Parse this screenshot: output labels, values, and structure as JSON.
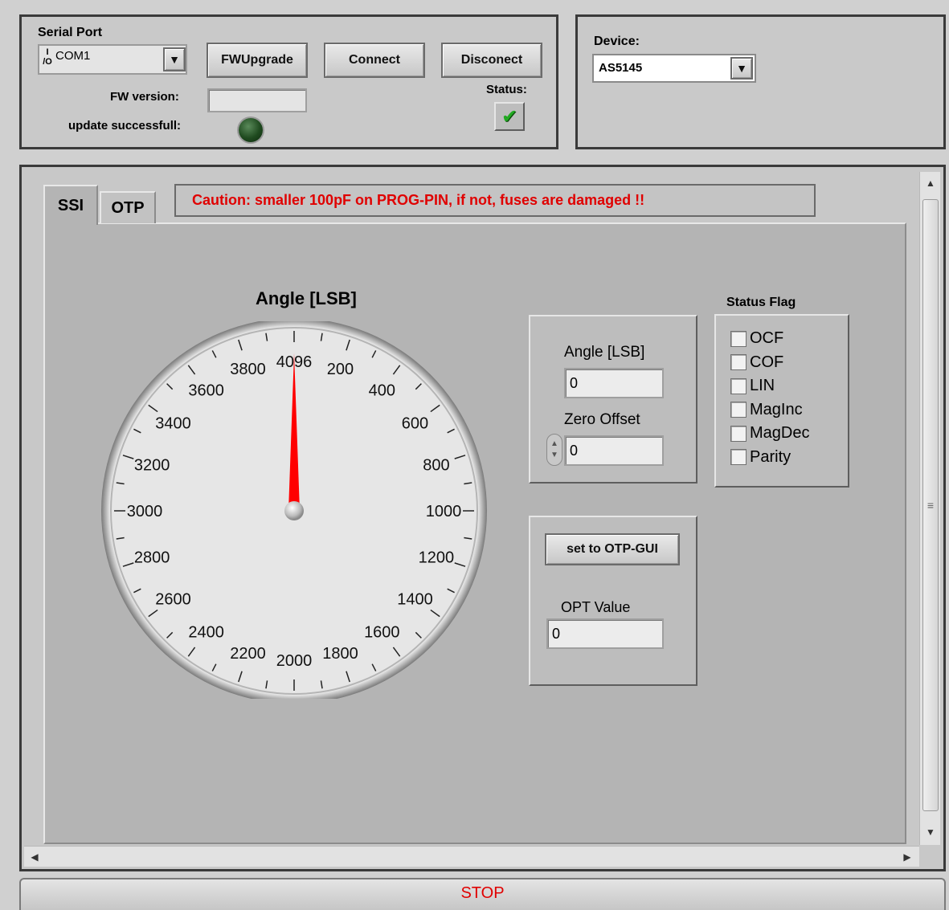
{
  "serial": {
    "title": "Serial Port",
    "io_icon_text": "I/O",
    "port_value": "COM1",
    "fwupgrade_label": "FWUpgrade",
    "connect_label": "Connect",
    "disconnect_label": "Disconect",
    "fw_version_label": "FW version:",
    "fw_version_value": "",
    "update_label": "update successfull:",
    "status_label": "Status:"
  },
  "device": {
    "label": "Device:",
    "value": "AS5145"
  },
  "tabs": [
    {
      "label": "SSI",
      "active": true
    },
    {
      "label": "OTP",
      "active": false
    }
  ],
  "caution": "Caution: smaller 100pF on PROG-PIN, if not, fuses are damaged !!",
  "gauge": {
    "title": "Angle [LSB]",
    "value": 0,
    "min": 0,
    "max": 4096,
    "major_ticks": [
      "4096",
      "200",
      "400",
      "600",
      "800",
      "1000",
      "1200",
      "1400",
      "1600",
      "1800",
      "2000",
      "2200",
      "2400",
      "2600",
      "2800",
      "3000",
      "3200",
      "3400",
      "3600",
      "3800"
    ],
    "needle_color": "#ff0000"
  },
  "angle_panel": {
    "angle_label": "Angle [LSB]",
    "angle_value": "0",
    "zero_offset_label": "Zero Offset",
    "zero_offset_value": "0"
  },
  "otp_panel": {
    "set_button_label": "set to OTP-GUI",
    "opt_label": "OPT Value",
    "opt_value": "0"
  },
  "status_flag": {
    "title": "Status Flag",
    "items": [
      {
        "label": "OCF",
        "checked": false
      },
      {
        "label": "COF",
        "checked": false
      },
      {
        "label": "LIN",
        "checked": false
      },
      {
        "label": "MagInc",
        "checked": false
      },
      {
        "label": "MagDec",
        "checked": false
      },
      {
        "label": "Parity",
        "checked": false
      }
    ]
  },
  "stop_label": "STOP",
  "colors": {
    "caution_text": "#e00000",
    "stop_text": "#e00000",
    "led_off": "#1f4a1f",
    "status_check": "#22aa22"
  }
}
